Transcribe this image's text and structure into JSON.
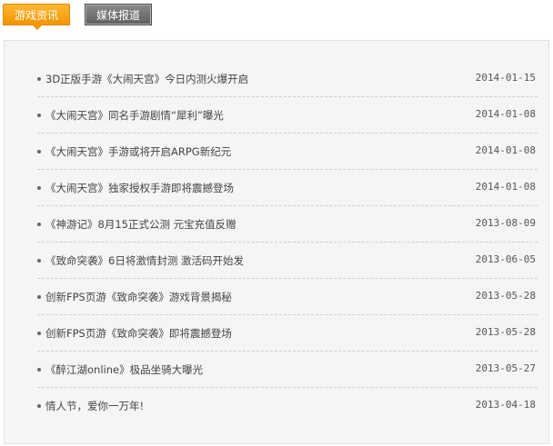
{
  "tabs": [
    {
      "label": "游戏资讯",
      "active": true
    },
    {
      "label": "媒体报道",
      "active": false
    }
  ],
  "colors": {
    "active_tab": "#f29500",
    "inactive_tab": "#6e6e6e",
    "panel_bg": "#f5f5f5"
  },
  "news": [
    {
      "title": "3D正版手游《大闹天宫》今日内测火爆开启",
      "date": "2014-01-15"
    },
    {
      "title": "《大闹天宫》同名手游剧情“犀利”曝光",
      "date": "2014-01-08"
    },
    {
      "title": "《大闹天宫》手游或将开启ARPG新纪元",
      "date": "2014-01-08"
    },
    {
      "title": "《大闹天宫》独家授权手游即将震撼登场",
      "date": "2014-01-08"
    },
    {
      "title": "《神游记》8月15正式公测 元宝充值反赠",
      "date": "2013-08-09"
    },
    {
      "title": "《致命突袭》6日将激情封测 激活码开始发",
      "date": "2013-06-05"
    },
    {
      "title": "创新FPS页游《致命突袭》游戏背景揭秘",
      "date": "2013-05-28"
    },
    {
      "title": "创新FPS页游《致命突袭》即将震撼登场",
      "date": "2013-05-28"
    },
    {
      "title": "《醉江湖online》极品坐骑大曝光",
      "date": "2013-05-27"
    },
    {
      "title": "情人节，爱你一万年!",
      "date": "2013-04-18"
    }
  ]
}
